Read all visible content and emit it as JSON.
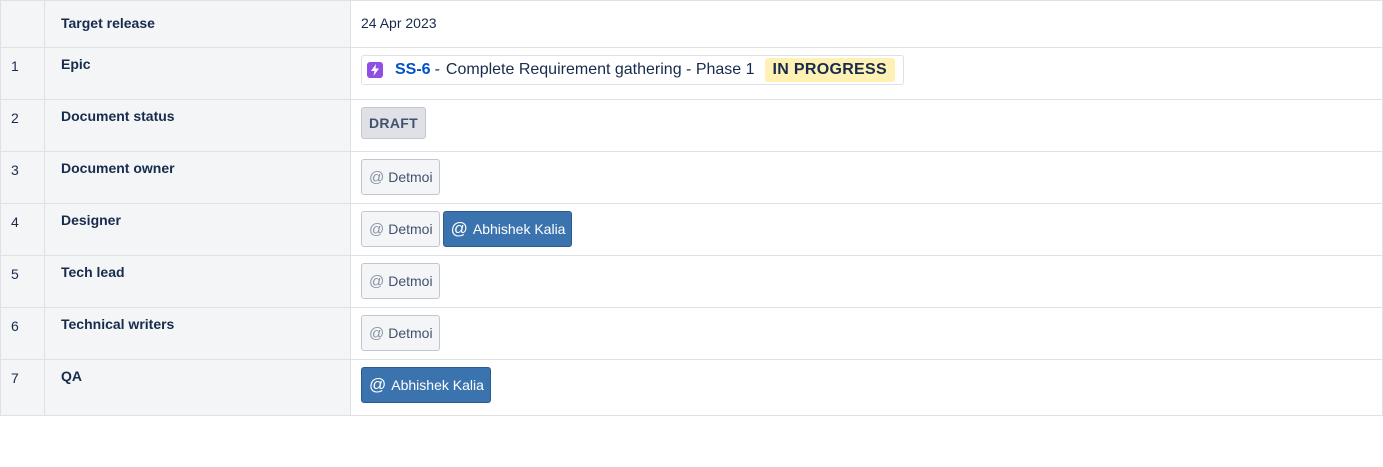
{
  "rows": [
    {
      "num": "",
      "key": "Target release",
      "value": "24 Apr 2023"
    },
    {
      "num": "1",
      "key": "Epic"
    },
    {
      "num": "2",
      "key": "Document status"
    },
    {
      "num": "3",
      "key": "Document owner"
    },
    {
      "num": "4",
      "key": "Designer"
    },
    {
      "num": "5",
      "key": "Tech lead"
    },
    {
      "num": "6",
      "key": "Technical writers"
    },
    {
      "num": "7",
      "key": "QA"
    }
  ],
  "epic": {
    "icon": "lightning-icon",
    "key": "SS-6",
    "separator": "-",
    "summary": "Complete Requirement gathering - Phase 1",
    "status": "IN PROGRESS"
  },
  "document_status": "DRAFT",
  "mentions": {
    "at_symbol": "@",
    "detmoi": "Detmoi",
    "abhishek": "Abhishek Kalia"
  },
  "colors": {
    "epic_icon": "#904ee2",
    "epic_key": "#0052cc",
    "status_in_progress_bg": "#fff0b3",
    "status_draft_bg": "#dfe1e6",
    "mention_self_bg": "#3b73af",
    "header_cell_bg": "#f4f5f7"
  }
}
